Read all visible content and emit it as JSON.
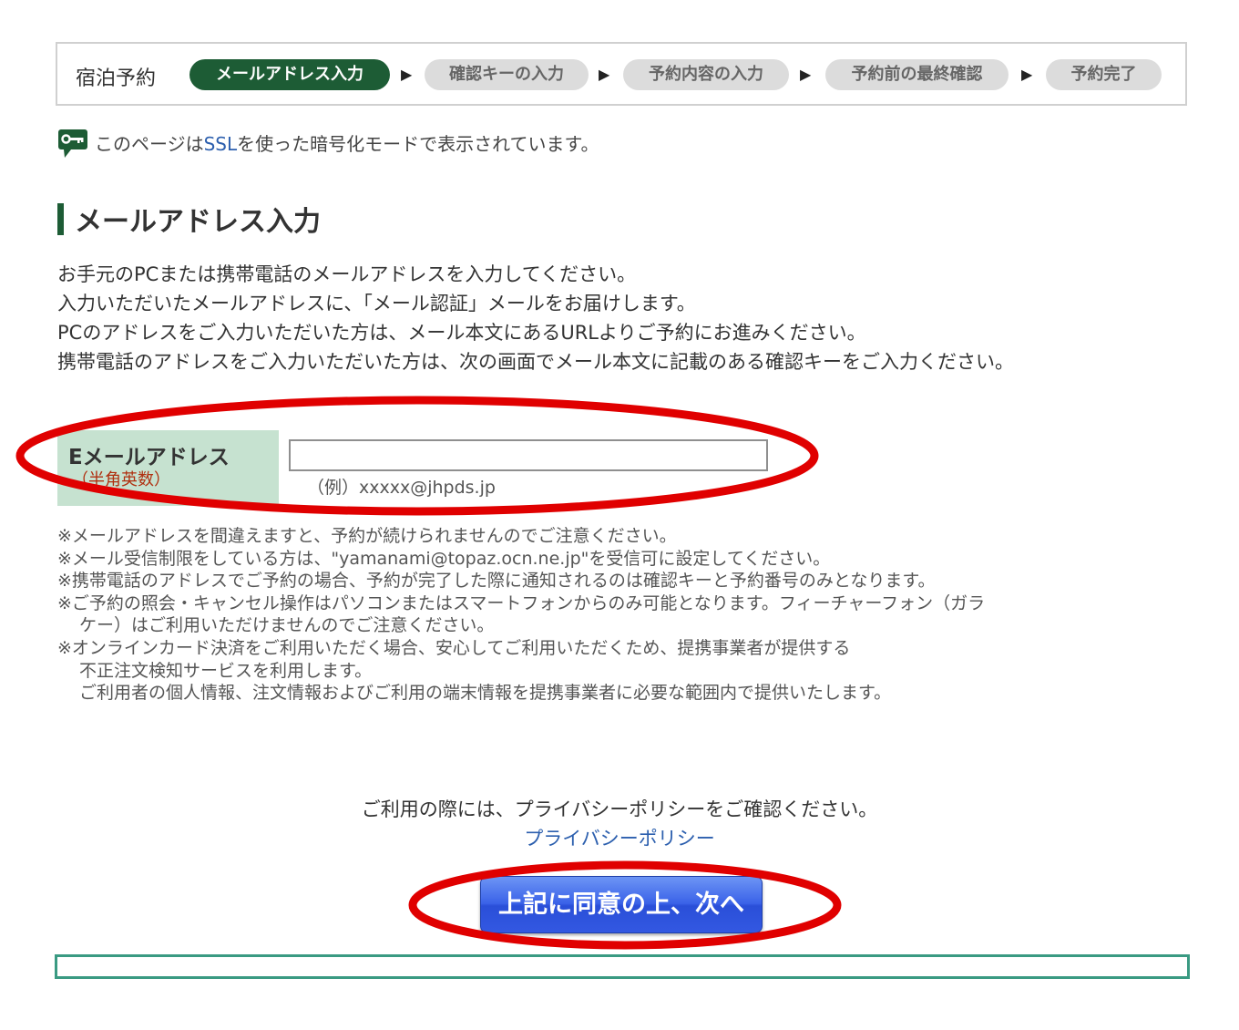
{
  "steps": {
    "title": "宿泊予約",
    "items": [
      {
        "label": "メールアドレス入力"
      },
      {
        "label": "確認キーの入力"
      },
      {
        "label": "予約内容の入力"
      },
      {
        "label": "予約前の最終確認"
      },
      {
        "label": "予約完了"
      }
    ],
    "active_index": 0,
    "separator": "▶"
  },
  "ssl_notice": {
    "prefix": "このページは",
    "ssl": "SSL",
    "suffix": "を使った暗号化モードで表示されています。",
    "icon": "key-icon"
  },
  "heading": "メールアドレス入力",
  "description": [
    "お手元のPCまたは携帯電話のメールアドレスを入力してください。",
    "入力いただいたメールアドレスに、「メール認証」メールをお届けします。",
    "PCのアドレスをご入力いただいた方は、メール本文にあるURLよりご予約にお進みください。",
    "携帯電話のアドレスをご入力いただいた方は、次の画面でメール本文に記載のある確認キーをご入力ください。"
  ],
  "email_form": {
    "label": "Eメールアドレス",
    "sublabel": "（半角英数）",
    "value": "",
    "example": "（例）xxxxx@jhpds.jp"
  },
  "notes": [
    "※メールアドレスを間違えますと、予約が続けられませんのでご注意ください。",
    "※メール受信制限をしている方は、\"yamanami@topaz.ocn.ne.jp\"を受信可に設定してください。",
    "※携帯電話のアドレスでご予約の場合、予約が完了した際に通知されるのは確認キーと予約番号のみとなります。",
    "※ご予約の照会・キャンセル操作はパソコンまたはスマートフォンからのみ可能となります。フィーチャーフォン（ガラ",
    "ケー）はご利用いただけませんのでご注意ください。",
    "※オンラインカード決済をご利用いただく場合、安心してご利用いただくため、提携事業者が提供する",
    "不正注文検知サービスを利用します。",
    "ご利用者の個人情報、注文情報およびご利用の端末情報を提携事業者に必要な範囲内で提供いたします。"
  ],
  "privacy": {
    "text": "ご利用の際には、プライバシーポリシーをご確認ください。",
    "link": "プライバシーポリシー"
  },
  "next_button": "上記に同意の上、次へ",
  "colors": {
    "brand_green": "#1d5c35",
    "inactive_step": "#dcdcdc",
    "label_bg": "#c6e2d0",
    "link_blue": "#2c5fae",
    "button_blue": "#3a62e8",
    "annotation_red": "#e00000",
    "bottom_border": "#3a9a82"
  }
}
